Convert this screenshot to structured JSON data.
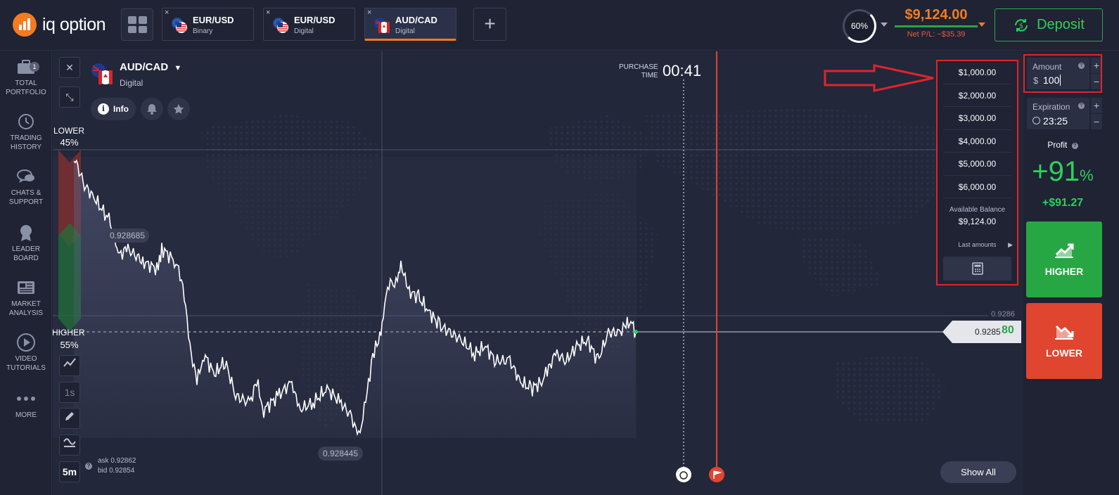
{
  "brand": {
    "name": "iq option",
    "accent": "#f47b20"
  },
  "tabs": [
    {
      "name": "EUR/USD",
      "type": "Binary",
      "active": false,
      "close": "×"
    },
    {
      "name": "EUR/USD",
      "type": "Digital",
      "active": false,
      "close": "×"
    },
    {
      "name": "AUD/CAD",
      "type": "Digital",
      "active": true,
      "close": "×"
    }
  ],
  "header": {
    "percent": "60%",
    "balance": "$9,124.00",
    "net_pl": "Net P/L: −$35.39",
    "deposit": "Deposit",
    "add_tab": "+"
  },
  "sidebar": {
    "items": [
      {
        "label1": "TOTAL",
        "label2": "PORTFOLIO",
        "icon": "briefcase-icon",
        "badge": "1"
      },
      {
        "label1": "TRADING",
        "label2": "HISTORY",
        "icon": "history-icon"
      },
      {
        "label1": "CHATS &",
        "label2": "SUPPORT",
        "icon": "chat-icon"
      },
      {
        "label1": "LEADER",
        "label2": "BOARD",
        "icon": "medal-icon"
      },
      {
        "label1": "MARKET",
        "label2": "ANALYSIS",
        "icon": "newspaper-icon"
      },
      {
        "label1": "VIDEO",
        "label2": "TUTORIALS",
        "icon": "play-icon"
      },
      {
        "label1": "MORE",
        "label2": "",
        "icon": "dots-icon"
      }
    ]
  },
  "asset": {
    "name": "AUD/CAD",
    "type": "Digital",
    "info": "Info",
    "purchase_line1": "PURCHASE",
    "purchase_line2": "TIME",
    "timer": "00:41"
  },
  "chart": {
    "lower_label": "LOWER",
    "lower_pct": "45%",
    "higher_label": "HIGHER",
    "higher_pct": "55%",
    "high_marker": "0.928685",
    "low_marker": "0.928445",
    "level_label": "0.9286",
    "price_main": "0.9285",
    "price_tail": "80",
    "ask": "ask 0.92862",
    "bid": "bid 0.92854",
    "timeframe_1": "1s",
    "timeframe_2": "5m",
    "show_all": "Show All"
  },
  "amount_options": [
    "$1,000.00",
    "$2,000.00",
    "$3,000.00",
    "$4,000.00",
    "$5,000.00",
    "$6,000.00"
  ],
  "available": {
    "label": "Available Balance",
    "value": "$9,124.00",
    "last": "Last amounts"
  },
  "trade": {
    "amount_label": "Amount",
    "currency": "$",
    "amount_value": "100",
    "expiration_label": "Expiration",
    "expiration_value": "23:25",
    "profit_label": "Profit",
    "profit_pct": "+91",
    "profit_pct_sign": "%",
    "profit_usd": "+$91.27",
    "higher": "HIGHER",
    "lower": "LOWER"
  },
  "colors": {
    "green": "#2fcf5a",
    "red": "#e55a3e",
    "higher_bg": "#27a744",
    "lower_bg": "#e0452f",
    "highlight": "#e0242c"
  }
}
